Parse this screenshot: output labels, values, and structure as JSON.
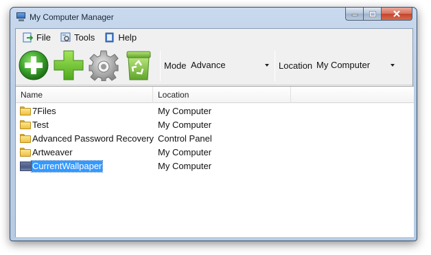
{
  "window": {
    "title": "My Computer Manager"
  },
  "menu": [
    {
      "label": "File",
      "icon": "file-menu-icon"
    },
    {
      "label": "Tools",
      "icon": "tools-menu-icon"
    },
    {
      "label": "Help",
      "icon": "help-menu-icon"
    }
  ],
  "toolbar": {
    "buttons": [
      {
        "icon": "add-circle-icon",
        "color": "#3aa02b"
      },
      {
        "icon": "plus-icon",
        "color": "#6cc230"
      },
      {
        "icon": "gear-icon",
        "color": "#9a9a9a"
      },
      {
        "icon": "recycle-bin-icon",
        "color": "#7cc043"
      }
    ],
    "mode_label": "Mode",
    "mode_value": "Advance",
    "location_label": "Location",
    "location_value": "My Computer"
  },
  "list": {
    "columns": [
      "Name",
      "Location"
    ],
    "rows": [
      {
        "name": "7Files",
        "location": "My Computer",
        "icon": "folder-icon"
      },
      {
        "name": "Test",
        "location": "My Computer",
        "icon": "folder-icon"
      },
      {
        "name": "Advanced Password Recovery",
        "location": "Control Panel",
        "icon": "folder-icon"
      },
      {
        "name": "Artweaver",
        "location": "My Computer",
        "icon": "folder-icon"
      },
      {
        "name": "CurrentWallpaper",
        "location": "My Computer",
        "icon": "wallpaper-icon",
        "selected": true
      }
    ]
  },
  "colors": {
    "selection": "#3399ff",
    "close_button": "#c4452b"
  }
}
